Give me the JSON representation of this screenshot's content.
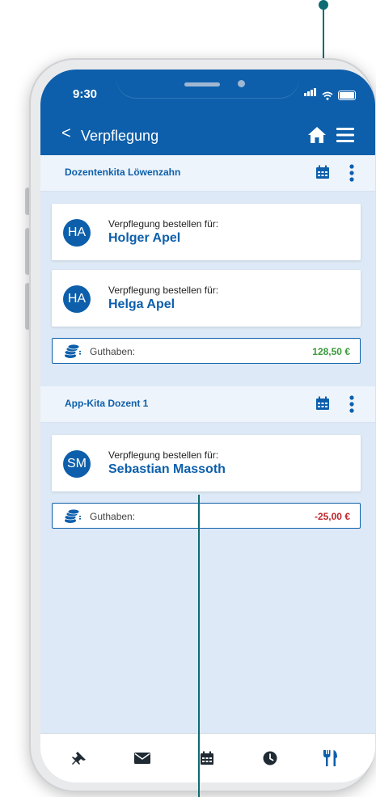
{
  "status": {
    "time": "9:30"
  },
  "nav": {
    "back_glyph": "<",
    "title": "Verpflegung"
  },
  "groups": [
    {
      "title": "Dozentenkita Löwenzahn",
      "persons": [
        {
          "initials": "HA",
          "label": "Verpflegung bestellen für:",
          "name": "Holger Apel"
        },
        {
          "initials": "HA",
          "label": "Verpflegung bestellen für:",
          "name": "Helga Apel"
        }
      ],
      "balance": {
        "label": "Guthaben:",
        "value": "128,50 €",
        "color": "#3a9a3a"
      }
    },
    {
      "title": "App-Kita Dozent 1",
      "persons": [
        {
          "initials": "SM",
          "label": "Verpflegung bestellen für:",
          "name": "Sebastian Massoth"
        }
      ],
      "balance": {
        "label": "Guthaben:",
        "value": "-25,00 €",
        "color": "#c0262c"
      }
    }
  ],
  "tabbar": {
    "items": [
      "pin-icon",
      "mail-icon",
      "calendar-icon",
      "clock-icon",
      "cutlery-icon"
    ],
    "active": "cutlery-icon"
  },
  "colors": {
    "primary": "#0d5fab",
    "background": "#dde9f6",
    "callout": "#0e6b73"
  }
}
